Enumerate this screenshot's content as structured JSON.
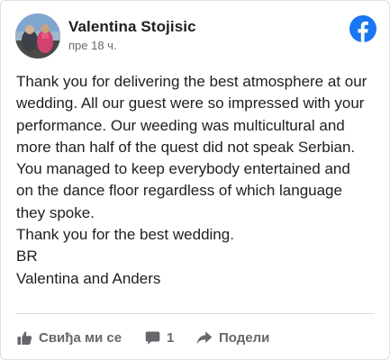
{
  "post": {
    "author": "Valentina Stojisic",
    "time": "пре 18 ч.",
    "lines": [
      "Thank you for delivering the best atmosphere at our",
      "wedding. All our guest were so impressed with your",
      "performance. Our weeding was multicultural and",
      "more than half of the quest did not speak Serbian.",
      "You managed to keep everybody entertained and",
      "on the dance floor regardless of which language",
      "they spoke.",
      "Thank you for the best wedding.",
      "BR",
      "Valentina and Anders"
    ]
  },
  "actions": {
    "like_label": "Свиђа ми се",
    "comment_count": "1",
    "share_label": "Подели"
  },
  "icons": {
    "brand": "facebook-logo-icon",
    "like": "thumbs-up-icon",
    "comment": "comment-icon",
    "share": "share-arrow-icon"
  },
  "colors": {
    "facebook_blue": "#1877f2",
    "text": "#1c1e21",
    "muted": "#65676b"
  }
}
